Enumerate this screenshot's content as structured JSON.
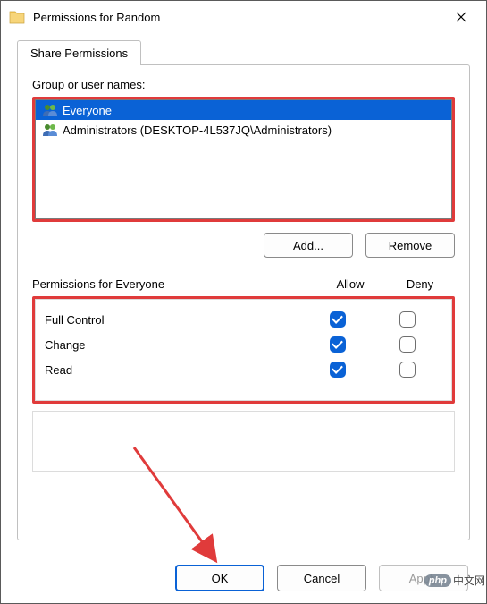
{
  "window": {
    "title": "Permissions for Random"
  },
  "tabs": {
    "share": "Share Permissions"
  },
  "list": {
    "label": "Group or user names:",
    "items": [
      {
        "name": "Everyone",
        "selected": true
      },
      {
        "name": "Administrators (DESKTOP-4L537JQ\\Administrators)",
        "selected": false
      }
    ]
  },
  "buttons": {
    "add": "Add...",
    "remove": "Remove",
    "ok": "OK",
    "cancel": "Cancel",
    "apply": "Apply"
  },
  "permissions": {
    "title": "Permissions for Everyone",
    "allow_label": "Allow",
    "deny_label": "Deny",
    "rows": [
      {
        "name": "Full Control",
        "allow": true,
        "deny": false
      },
      {
        "name": "Change",
        "allow": true,
        "deny": false
      },
      {
        "name": "Read",
        "allow": true,
        "deny": false
      }
    ]
  },
  "watermark": {
    "brand": "php",
    "text": "中文网"
  }
}
